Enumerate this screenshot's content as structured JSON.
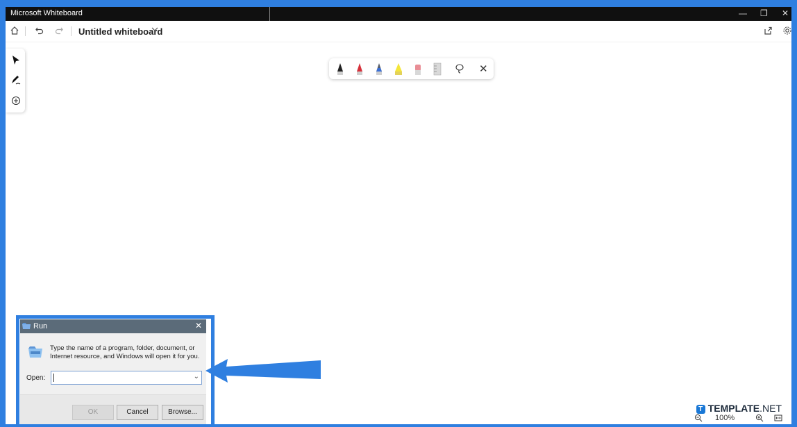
{
  "window": {
    "title": "Microsoft Whiteboard"
  },
  "toolbar": {
    "board_title": "Untitled whiteboard"
  },
  "status": {
    "zoom": "100%"
  },
  "watermark": {
    "brand": "TEMPLATE",
    "suffix": ".NET"
  },
  "run_dialog": {
    "title": "Run",
    "description": "Type the name of a program, folder, document, or Internet resource, and Windows will open it for you.",
    "open_label": "Open:",
    "open_value": "",
    "ok_label": "OK",
    "cancel_label": "Cancel",
    "browse_label": "Browse..."
  },
  "colors": {
    "accent_blue": "#2f7fe0",
    "titlebar": "#101010",
    "run_titlebar": "#5b6b79"
  },
  "pens": [
    {
      "name": "black-pen-icon",
      "color": "#222222"
    },
    {
      "name": "red-pen-icon",
      "color": "#d6303a"
    },
    {
      "name": "blue-pen-icon",
      "color": "#3a6fd6"
    },
    {
      "name": "yellow-highlighter-icon",
      "color": "#f4e63a"
    },
    {
      "name": "eraser-icon",
      "color": "#e98e96"
    },
    {
      "name": "ruler-icon",
      "color": "#b0b0b0"
    }
  ]
}
